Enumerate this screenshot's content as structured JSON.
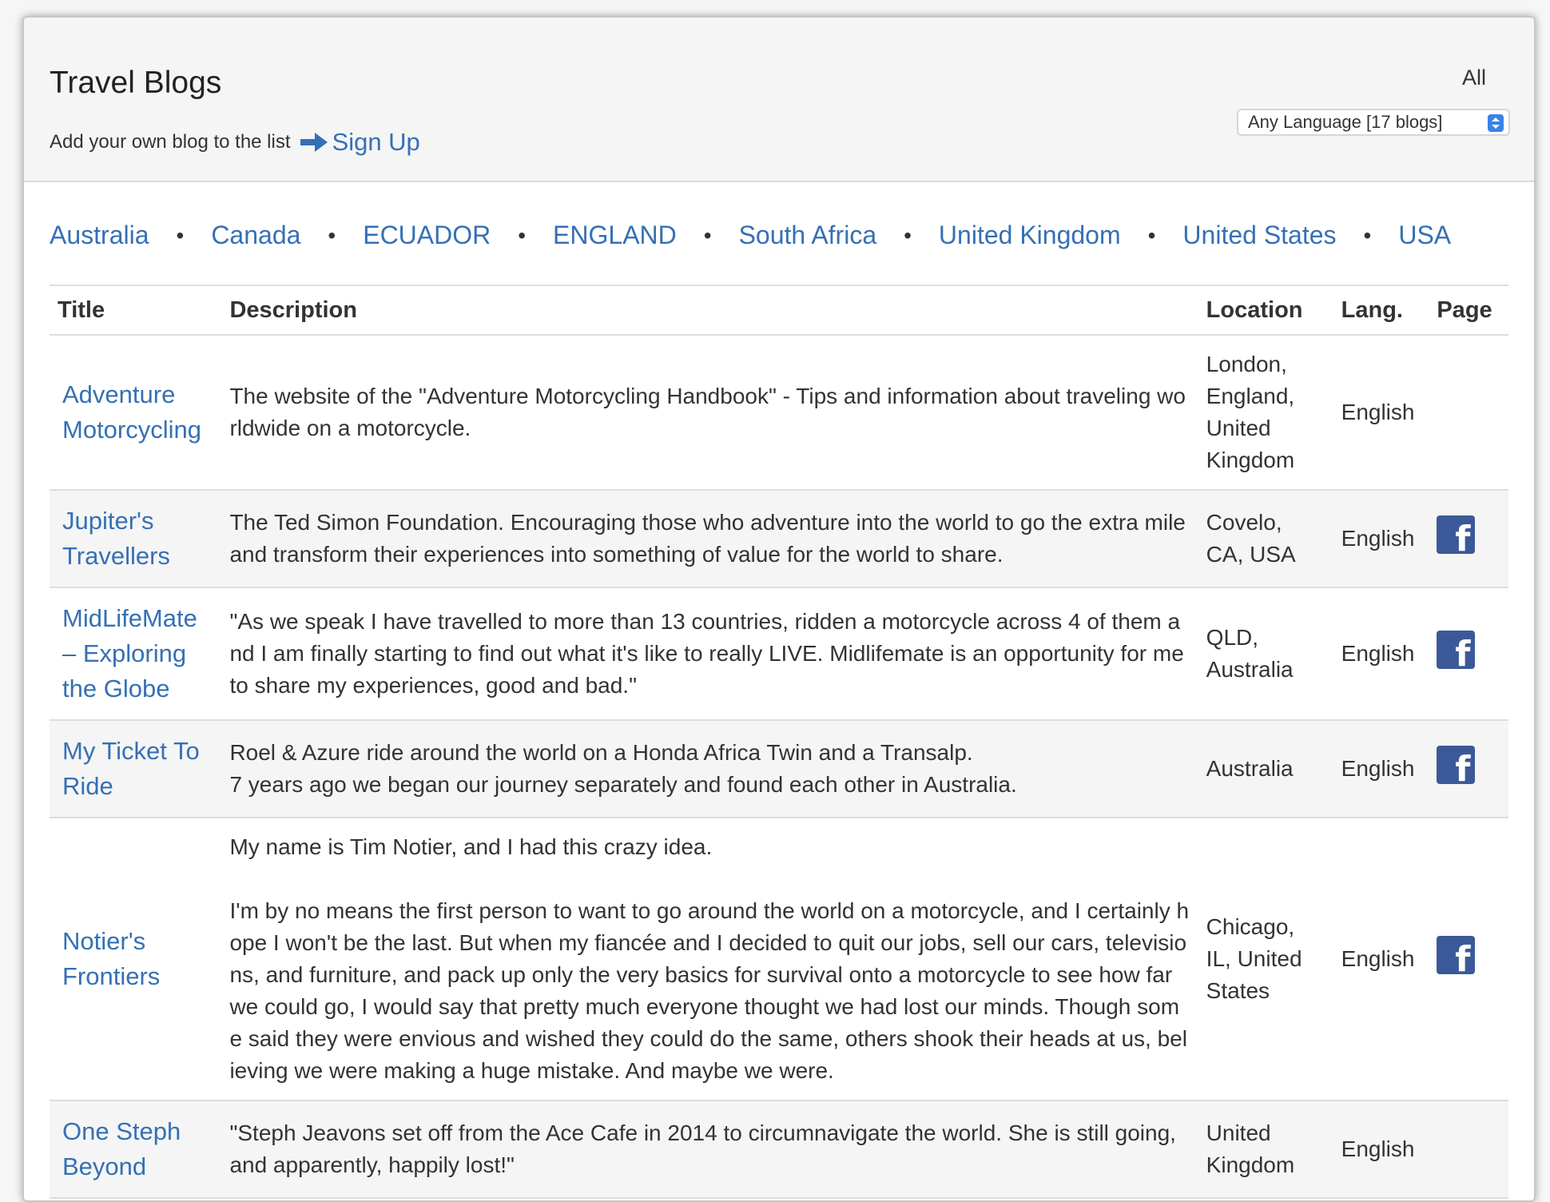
{
  "header": {
    "title": "Travel Blogs",
    "subtitle": "Add your own blog to the list",
    "signup_label": "Sign Up",
    "all_label": "All",
    "language_select": "Any Language [17 blogs]"
  },
  "countries": [
    "Australia",
    "Canada",
    "ECUADOR",
    "ENGLAND",
    "South Africa",
    "United Kingdom",
    "United States",
    "USA"
  ],
  "table": {
    "headers": [
      "Title",
      "Description",
      "Location",
      "Lang.",
      "Page"
    ],
    "rows": [
      {
        "title": "Adventure Motorcycling",
        "description": "The website of the \"Adventure Motorcycling Handbook\" - Tips and information about traveling worldwide on a motorcycle.",
        "location": "London, England, United Kingdom",
        "lang": "English",
        "page": false
      },
      {
        "title": "Jupiter's Travellers",
        "description": "The Ted Simon Foundation. Encouraging those who adventure into the world to go the extra mile and transform their experiences into something of value for the world to share.",
        "location": "Covelo, CA, USA",
        "lang": "English",
        "page": true
      },
      {
        "title": "MidLifeMate – Exploring the Globe",
        "description": "\"As we speak I have travelled to more than 13 countries, ridden a motorcycle across 4 of them and I am finally starting to find out what it's like to really LIVE. Midlifemate is an opportunity for me to share my experiences, good and bad.\"",
        "location": "QLD, Australia",
        "lang": "English",
        "page": true
      },
      {
        "title": "My Ticket To Ride",
        "description": "Roel & Azure ride around the world on a Honda Africa Twin and a Transalp.\n7 years ago we began our journey separately and found each other in Australia.",
        "location": "Australia",
        "lang": "English",
        "page": true
      },
      {
        "title": "Notier's Frontiers",
        "description": "My name is Tim Notier, and I had this crazy idea.\n\nI'm by no means the first person to want to go around the world on a motorcycle, and I certainly hope I won't be the last. But when my fiancée and I decided to quit our jobs, sell our cars, televisions, and furniture, and pack up only the very basics for survival onto a motorcycle to see how far we could go, I would say that pretty much everyone thought we had lost our minds. Though some said they were envious and wished they could do the same, others shook their heads at us, believing we were making a huge mistake. And maybe we were.",
        "location": "Chicago, IL, United States",
        "lang": "English",
        "page": true
      },
      {
        "title": "One Steph Beyond",
        "description": "\"Steph Jeavons set off from the Ace Cafe in 2014 to circumnavigate the world. She is still going, and apparently, happily lost!\"",
        "location": "United Kingdom",
        "lang": "English",
        "page": false
      }
    ]
  },
  "colors": {
    "link": "#3570b5",
    "facebook": "#3b5998",
    "select_accent": "#3b82e6"
  }
}
